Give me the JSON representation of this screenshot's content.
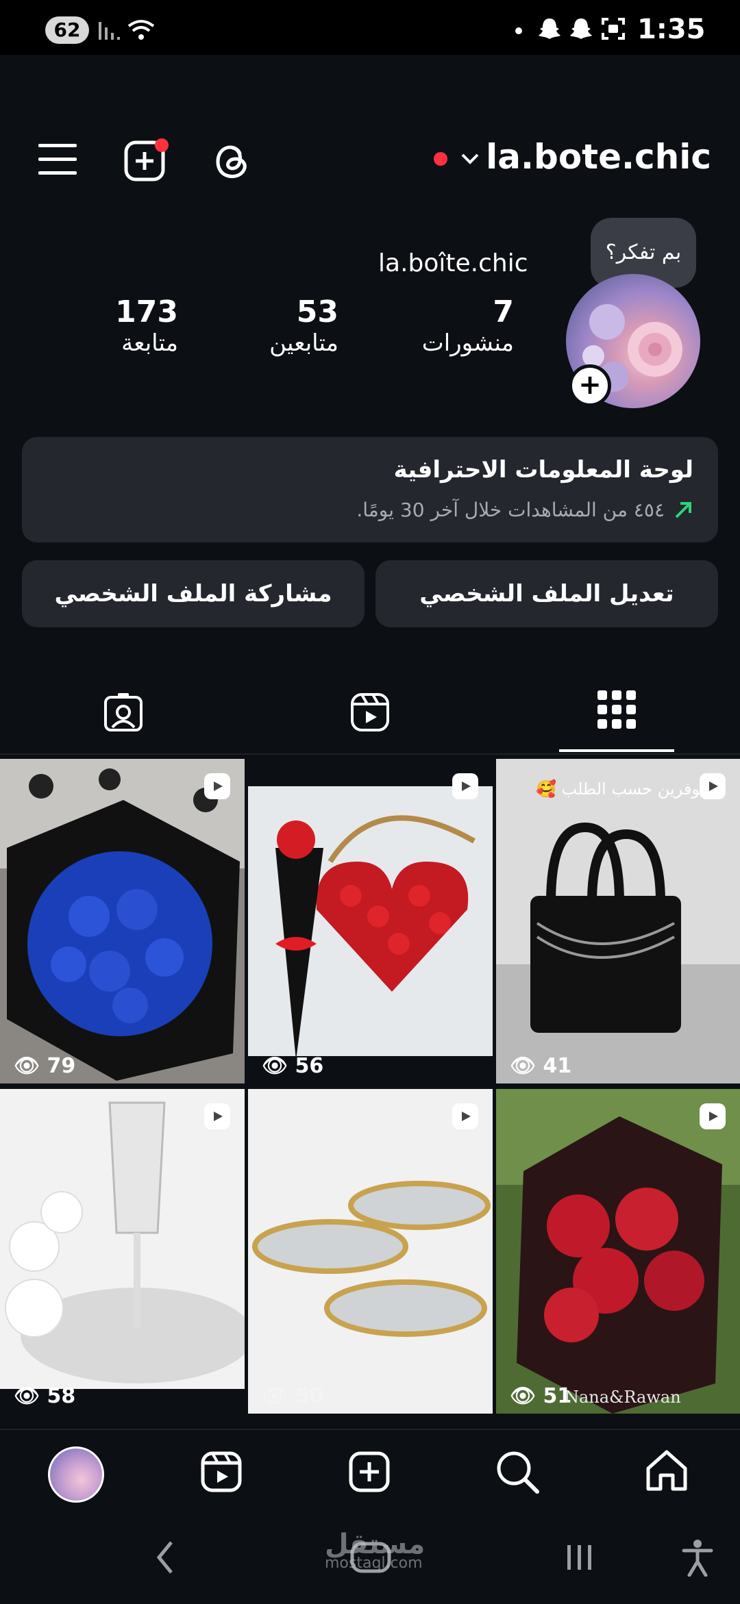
{
  "status_bar": {
    "battery": "62",
    "time": "1:35"
  },
  "header": {
    "username": "la.bote.chic"
  },
  "profile": {
    "thought_bubble": "بم تفكر؟",
    "display_name": "la.boîte.chic",
    "stats": [
      {
        "value": "7",
        "label": "منشورات"
      },
      {
        "value": "53",
        "label": "متابعين"
      },
      {
        "value": "173",
        "label": "متابعة"
      }
    ]
  },
  "dashboard": {
    "title": "لوحة المعلومات الاحترافية",
    "subtitle": "٤٥٤ من المشاهدات خلال آخر 30 يومًا."
  },
  "buttons": {
    "edit_profile": "تعديل الملف الشخصي",
    "share_profile": "مشاركة الملف الشخصي"
  },
  "tabs": [
    "grid-icon",
    "reels-icon",
    "tagged-icon"
  ],
  "posts": [
    {
      "views": "79",
      "caption": ""
    },
    {
      "views": "56",
      "caption": ""
    },
    {
      "views": "41",
      "caption": "متوفرين حسب الطلب 🥰"
    },
    {
      "views": "58",
      "caption": ""
    },
    {
      "views": "50",
      "caption": ""
    },
    {
      "views": "51",
      "caption": "Nana&Rawan"
    }
  ],
  "watermark": {
    "text": "مستقل",
    "sub": "mostaql.com"
  },
  "colors": {
    "background": "#0c0f14",
    "card": "#24272e",
    "accent_red": "#ff3040",
    "trend_green": "#2fd37a"
  }
}
